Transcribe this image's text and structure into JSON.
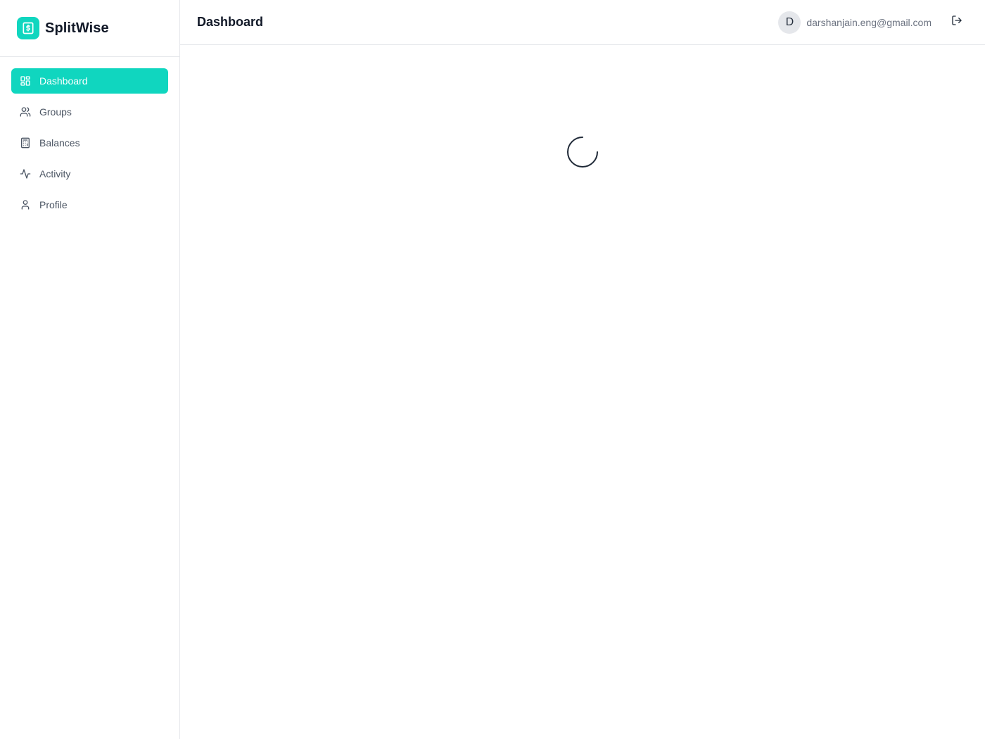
{
  "brand": {
    "name": "SplitWise",
    "logo_icon": "dollar-receipt-icon",
    "accent": "#10d6bf"
  },
  "sidebar": {
    "items": [
      {
        "label": "Dashboard",
        "icon": "layout-grid-icon",
        "active": true
      },
      {
        "label": "Groups",
        "icon": "users-icon",
        "active": false
      },
      {
        "label": "Balances",
        "icon": "calculator-icon",
        "active": false
      },
      {
        "label": "Activity",
        "icon": "activity-icon",
        "active": false
      },
      {
        "label": "Profile",
        "icon": "user-icon",
        "active": false
      }
    ]
  },
  "header": {
    "title": "Dashboard",
    "user": {
      "initial": "D",
      "email": "darshanjain.eng@gmail.com"
    },
    "logout_icon": "logout-icon"
  },
  "main": {
    "loading": true,
    "spinner_icon": "loading-spinner-icon"
  }
}
